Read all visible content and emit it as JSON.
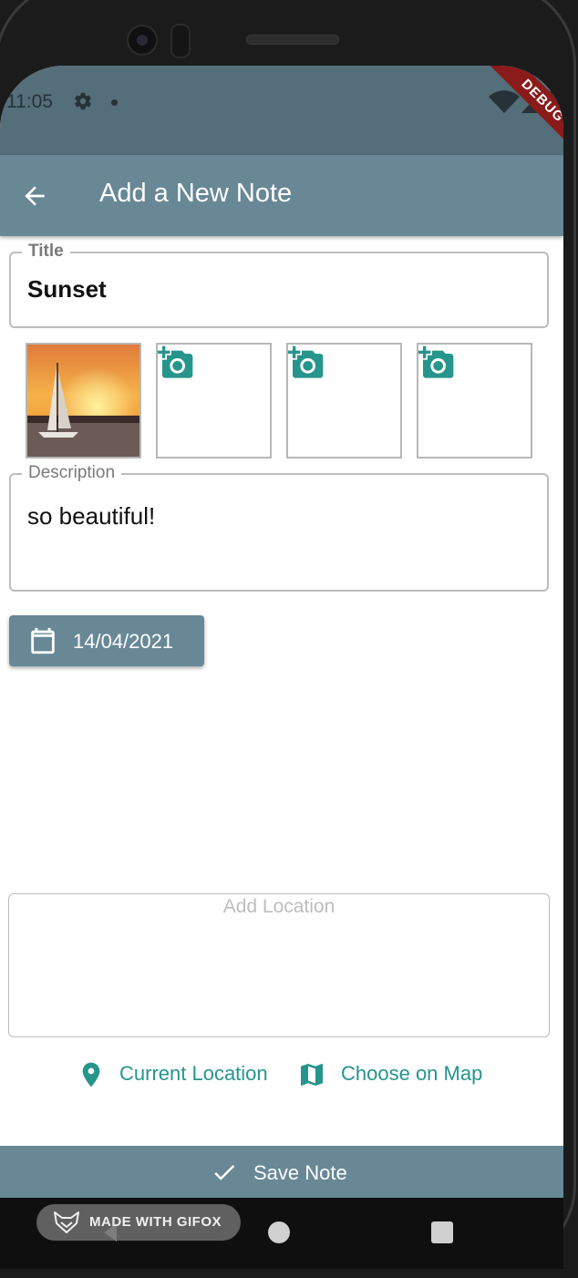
{
  "status_bar": {
    "time": "11:05",
    "debug_label": "DEBUG"
  },
  "app_bar": {
    "title": "Add a New Note",
    "back_icon": "arrow-back-icon"
  },
  "form": {
    "title_label": "Title",
    "title_value": "Sunset",
    "photos": [
      {
        "type": "image",
        "description_icon": "photo-thumbnail"
      },
      {
        "type": "add",
        "icon": "add-a-photo-icon"
      },
      {
        "type": "add",
        "icon": "add-a-photo-icon"
      },
      {
        "type": "add",
        "icon": "add-a-photo-icon"
      }
    ],
    "description_label": "Description",
    "description_value": "so beautiful!",
    "date_value": "14/04/2021",
    "date_icon": "calendar-icon",
    "location_placeholder": "Add Location",
    "current_location_label": "Current Location",
    "choose_on_map_label": "Choose on Map",
    "save_label": "Save Note"
  },
  "watermark": {
    "text": "MADE WITH GIFOX"
  },
  "colors": {
    "status_bar": "#546e7a",
    "app_bar": "#688896",
    "accent": "#26958c",
    "border": "#bdbdbd"
  }
}
